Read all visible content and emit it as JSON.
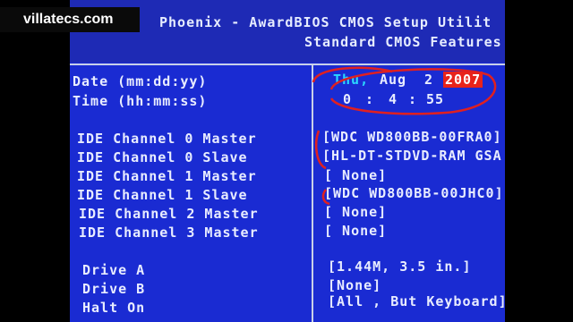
{
  "watermark": "villatecs.com",
  "header": {
    "title": "Phoenix - AwardBIOS CMOS Setup Utilit",
    "subtitle": "Standard CMOS Features"
  },
  "labels": {
    "date": "Date (mm:dd:yy)",
    "time": "Time (hh:mm:ss)",
    "ide0m": "IDE Channel 0 Master",
    "ide0s": "IDE Channel 0 Slave",
    "ide1m": "IDE Channel 1 Master",
    "ide1s": "IDE Channel 1 Slave",
    "ide2m": "IDE Channel 2 Master",
    "ide3m": "IDE Channel 3 Master",
    "drivea": "Drive A",
    "driveb": "Drive B",
    "halt": "Halt On"
  },
  "values": {
    "day": "Thu,",
    "month": "Aug",
    "date_num": "2",
    "year": "2007",
    "hour": "0",
    "minute": "4",
    "second": "55",
    "sep": ":",
    "ide0m": "[WDC WD800BB-00FRA0]",
    "ide0s": "[HL-DT-STDVD-RAM GSA",
    "ide1m": "[ None]",
    "ide1s": "[WDC WD800BB-00JHC0]",
    "ide2m": "[ None]",
    "ide3m": "[ None]",
    "drivea": "[1.44M, 3.5 in.]",
    "driveb": "[None]",
    "halt": "[All , But Keyboard]"
  },
  "colors": {
    "background": "#1a2bd2",
    "text": "#e8ecff",
    "highlight": "#e8231b",
    "annotation": "#e02020"
  }
}
